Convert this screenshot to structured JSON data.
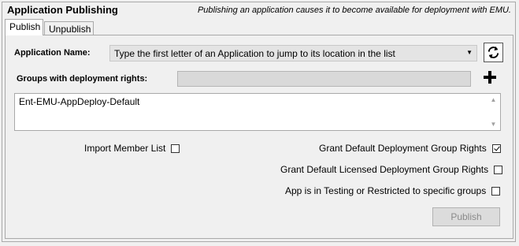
{
  "group": {
    "title": "Application Publishing",
    "hint": "Publishing an application causes it to become available for deployment with EMU."
  },
  "tabs": [
    {
      "label": "Publish",
      "active": true
    },
    {
      "label": "Unpublish",
      "active": false
    }
  ],
  "form": {
    "app_name_label": "Application Name:",
    "app_name_value": "Type the first letter of an Application to jump to its location in the list",
    "groups_label": "Groups with deployment rights:",
    "groups_input_value": "",
    "groups_list": [
      "Ent-EMU-AppDeploy-Default"
    ],
    "options": {
      "import_member_list": {
        "label": "Import Member List",
        "checked": false
      },
      "grant_default_deployment": {
        "label": "Grant Default Deployment Group Rights",
        "checked": true
      },
      "grant_default_licensed": {
        "label": "Grant Default Licensed Deployment Group Rights",
        "checked": false
      },
      "app_in_testing": {
        "label": "App is in Testing or Restricted to specific groups",
        "checked": false
      }
    },
    "publish_label": "Publish",
    "publish_enabled": false
  },
  "icons": {
    "refresh": "refresh-icon",
    "add": "plus-icon",
    "dropdown": "chevron-down-icon"
  }
}
